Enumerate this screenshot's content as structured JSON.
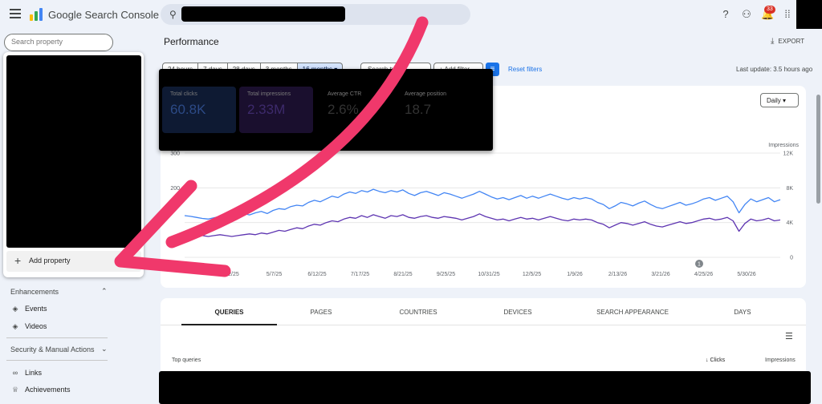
{
  "topbar": {
    "app_title": "Google Search Console",
    "notification_count": "33"
  },
  "sidebar": {
    "search_placeholder": "Search property",
    "add_property": "Add property",
    "sections": [
      {
        "label": "Enhancements",
        "expanded": true,
        "items": [
          {
            "label": "Events",
            "icon": "layers-icon"
          },
          {
            "label": "Videos",
            "icon": "layers-icon"
          }
        ]
      },
      {
        "label": "Security & Manual Actions",
        "expanded": false,
        "items": [
          {
            "label": "Links",
            "icon": "link-icon"
          },
          {
            "label": "Achievements",
            "icon": "trophy-icon"
          }
        ]
      }
    ]
  },
  "main": {
    "title": "Performance",
    "export_label": "EXPORT",
    "date_ranges": [
      "24 hours",
      "7 days",
      "28 days",
      "3 months",
      "16 months"
    ],
    "selected_range": "16 months",
    "search_type_label": "Search type",
    "add_filter_label": "Add filter",
    "reset_filters": "Reset filters",
    "last_update": "Last update: 3.5 hours ago",
    "granularity": "Daily",
    "metrics": [
      {
        "label": "Total clicks",
        "value": "60.8K",
        "color": "#4285f4"
      },
      {
        "label": "Total impressions",
        "value": "2.33M",
        "color": "#5e35b1"
      },
      {
        "label": "Average CTR",
        "value": "2.6%",
        "color": "#00897b"
      },
      {
        "label": "Average position",
        "value": "18.7",
        "color": "#e8710a"
      }
    ]
  },
  "chart_data": {
    "type": "line",
    "x_ticks": [
      "4/2/25",
      "5/7/25",
      "6/12/25",
      "7/17/25",
      "8/21/25",
      "9/25/25",
      "10/31/25",
      "12/5/25",
      "1/9/26",
      "2/13/26",
      "3/21/26",
      "4/25/26",
      "5/30/26"
    ],
    "left_axis_ticks": [
      "300",
      "200"
    ],
    "right_axis_title": "Impressions",
    "right_axis_ticks": [
      "12K",
      "8K",
      "4K",
      "0"
    ],
    "annotation_marker": "1",
    "series": [
      {
        "color": "#4285f4",
        "axis": "left",
        "values": [
          120,
          118,
          115,
          112,
          110,
          114,
          118,
          112,
          115,
          120,
          126,
          122,
          128,
          132,
          126,
          135,
          140,
          138,
          146,
          150,
          148,
          158,
          164,
          160,
          168,
          176,
          172,
          182,
          188,
          184,
          192,
          188,
          196,
          190,
          186,
          192,
          188,
          194,
          184,
          178,
          186,
          190,
          184,
          178,
          186,
          182,
          176,
          170,
          176,
          182,
          190,
          182,
          174,
          168,
          172,
          166,
          172,
          178,
          170,
          176,
          170,
          176,
          182,
          176,
          170,
          166,
          172,
          168,
          172,
          168,
          158,
          152,
          140,
          148,
          158,
          154,
          148,
          156,
          162,
          152,
          144,
          140,
          146,
          152,
          158,
          150,
          154,
          160,
          168,
          172,
          164,
          170,
          176,
          160,
          128,
          152,
          168,
          160,
          166,
          172,
          160,
          166
        ]
      },
      {
        "color": "#5e35b1",
        "axis": "right",
        "values": [
          2800,
          2700,
          2600,
          2500,
          2400,
          2500,
          2600,
          2500,
          2400,
          2500,
          2600,
          2700,
          2600,
          2800,
          2700,
          2900,
          3100,
          3000,
          3200,
          3400,
          3300,
          3600,
          3800,
          3700,
          4000,
          4200,
          4100,
          4400,
          4600,
          4500,
          4800,
          4600,
          4900,
          4700,
          4500,
          4800,
          4700,
          4900,
          4600,
          4500,
          4700,
          4800,
          4600,
          4500,
          4700,
          4600,
          4500,
          4300,
          4500,
          4700,
          5000,
          4700,
          4500,
          4300,
          4400,
          4200,
          4400,
          4600,
          4400,
          4500,
          4300,
          4500,
          4700,
          4500,
          4300,
          4200,
          4400,
          4300,
          4400,
          4300,
          4000,
          3800,
          3400,
          3700,
          4000,
          3900,
          3700,
          3900,
          4100,
          3800,
          3600,
          3500,
          3700,
          3900,
          4100,
          3900,
          4000,
          4200,
          4400,
          4500,
          4300,
          4400,
          4600,
          4200,
          3000,
          3900,
          4400,
          4200,
          4300,
          4500,
          4200,
          4300
        ]
      }
    ]
  },
  "tabs": [
    "QUERIES",
    "PAGES",
    "COUNTRIES",
    "DEVICES",
    "SEARCH APPEARANCE",
    "DAYS"
  ],
  "selected_tab": "QUERIES",
  "table": {
    "headers": {
      "query": "Top queries",
      "clicks": "Clicks",
      "impressions": "Impressions"
    },
    "sort_arrow": "↓"
  },
  "colors": {
    "annotation_arrow": "#f0386b",
    "accent": "#1a73e8"
  }
}
